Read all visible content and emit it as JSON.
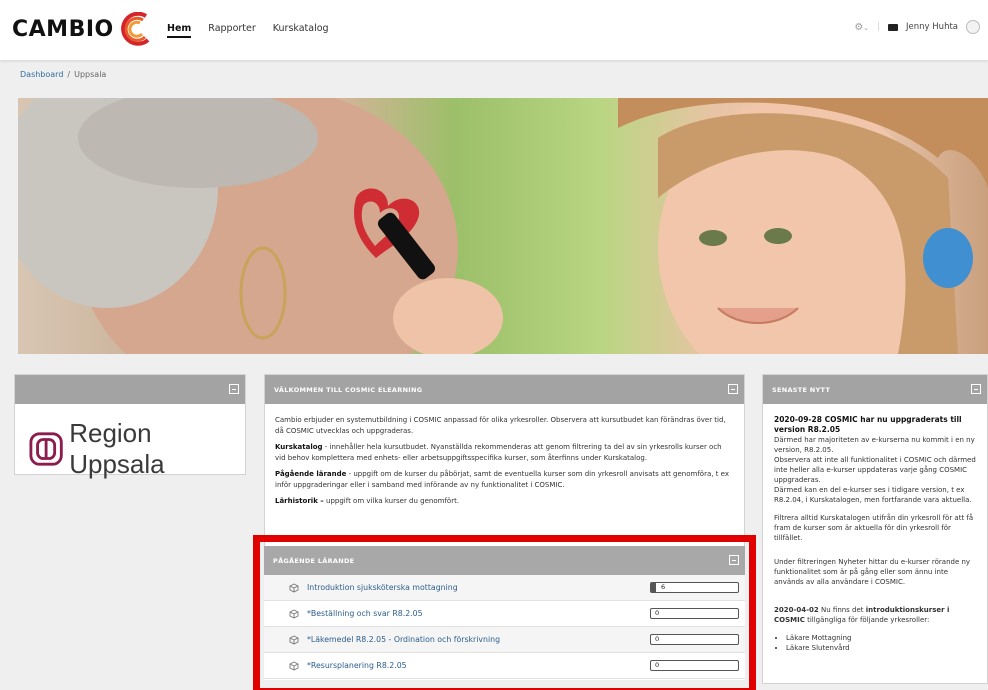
{
  "header": {
    "logo_text": "CAMBIO",
    "nav": [
      {
        "label": "Hem",
        "active": true
      },
      {
        "label": "Rapporter",
        "active": false
      },
      {
        "label": "Kurskatalog",
        "active": false
      }
    ],
    "user_name": "Jenny Huhta",
    "icons": [
      "gear-icon",
      "chevron-down-icon",
      "mail-icon",
      "avatar"
    ]
  },
  "breadcrumb": {
    "root": "Dashboard",
    "sep": "/",
    "current": "Uppsala"
  },
  "left_block": {
    "region_name": "Region Uppsala"
  },
  "welcome": {
    "title": "VÄLKOMMEN TILL COSMIC ELEARNING",
    "intro": "Cambio erbjuder en systemutbildning i COSMIC anpassad för olika yrkesroller. Observera att kursutbudet kan förändras över tid, då COSMIC utvecklas och uppgraderas.",
    "p1_bold": "Kurskatalog",
    "p1_text": " - innehåller hela kursutbudet. Nyanställda rekommenderas att genom filtrering ta del av sin yrkesrolls kurser och vid behov komplettera med enhets- eller arbetsuppgiftsspecifika kurser, som återfinns under Kurskatalog.",
    "p2_bold": "Pågående lärande",
    "p2_text": " - uppgift om de kurser du påbörjat, samt de eventuella kurser som din yrkesroll anvisats att genomföra, t ex inför uppgraderingar eller i samband med införande av ny funktionalitet i COSMIC.",
    "p3_bold": "Lärhistorik –",
    "p3_text": " uppgift om vilka kurser du genomfört."
  },
  "ongoing": {
    "title": "PÅGÅENDE LÄRANDE",
    "courses": [
      {
        "name": "Introduktion sjuksköterska mottagning",
        "progress": 6
      },
      {
        "name": "*Beställning och svar R8.2.05",
        "progress": 0
      },
      {
        "name": "*Läkemedel R8.2.05 - Ordination och förskrivning",
        "progress": 0
      },
      {
        "name": "*Resursplanering R8.2.05",
        "progress": 0
      }
    ]
  },
  "news": {
    "title": "SENASTE NYTT",
    "item1_title": "2020-09-28 COSMIC har nu uppgraderats till version R8.2.05",
    "item1_text1": "Därmed har majoriteten av e-kurserna nu kommit i en ny version, R8.2.05.",
    "item1_text2": "Observera att inte all funktionalitet i COSMIC och därmed inte heller alla e-kurser uppdateras varje gång COSMIC uppgraderas.",
    "item1_text3": "Därmed kan en del e-kurser ses i tidigare version, t ex R8.2.04, i Kurskatalogen, men fortfarande vara aktuella.",
    "item1_text4": "Filtrera alltid Kurskatalogen utifrån din yrkesroll för att få fram de kurser som är aktuella för din yrkesroll för tillfället.",
    "item1_text5": "Under filtreringen Nyheter hittar du e-kurser rörande ny funktionalitet som är på gång eller som ännu inte används av alla användare i COSMIC.",
    "item2_date": "2020-04-02",
    "item2_pre": " Nu finns det ",
    "item2_bold": "introduktionskurser i COSMIC",
    "item2_post": " tillgängliga för följande yrkesroller:",
    "item2_list": [
      "Läkare Mottagning",
      "Läkare Slutenvård"
    ]
  },
  "colors": {
    "panel_header": "#a3a3a3",
    "link": "#2c5d8c",
    "highlight": "#e00000"
  }
}
